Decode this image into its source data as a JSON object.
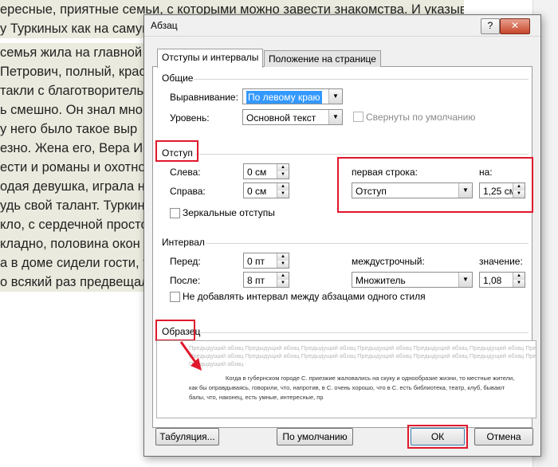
{
  "document": {
    "lines": [
      "ересные, приятные семьи, с которыми можно завести знакомства. И указывали на",
      "у Туркиных как на самую образованную и талантливую.",
      "семья жила на главной ул",
      " Петрович, полный, крас",
      "такли с благотворительн",
      "ь смешно. Он знал много",
      "у него было такое выр",
      "езно. Жена его, Вера Иос",
      "ести и романы и охотно чи",
      "одая девушка, играла на р",
      "удь свой талант. Туркины",
      "кло, с сердечной простот",
      "кладно, половина окон вы",
      "а в доме сидели гости, то",
      "о всякий раз предвещало"
    ]
  },
  "dialog": {
    "title": "Абзац",
    "help": "?",
    "close": "✕",
    "tabs": [
      "Отступы и интервалы",
      "Положение на странице"
    ],
    "general": {
      "header": "Общие",
      "alignment_label": "Выравнивание:",
      "alignment_value": "По левому краю",
      "level_label": "Уровень:",
      "level_value": "Основной текст",
      "collapsed_label": "Свернуты по умолчанию"
    },
    "indent": {
      "header": "Отступ",
      "left_label": "Слева:",
      "left_value": "0 см",
      "right_label": "Справа:",
      "right_value": "0 см",
      "mirror_label": "Зеркальные отступы",
      "first_line_label": "первая строка:",
      "first_line_value": "Отступ",
      "by_label": "на:",
      "by_value": "1,25 см"
    },
    "spacing": {
      "header": "Интервал",
      "before_label": "Перед:",
      "before_value": "0 пт",
      "after_label": "После:",
      "after_value": "8 пт",
      "line_label": "междустрочный:",
      "line_value": "Множитель",
      "at_label": "значение:",
      "at_value": "1,08",
      "no_space_label": "Не добавлять интервал между абзацами одного стиля"
    },
    "preview": {
      "header": "Образец",
      "prev_line1": "Предыдущий абзац Предыдущий абзац Предыдущий абзац Предыдущий абзац Предыдущий абзац Предыдущий абзац Предыдущий абзац",
      "prev_line2": "Предыдущий абзац Предыдущий абзац Предыдущий абзац Предыдущий абзац Предыдущий абзац Предыдущий абзац Предыдущий абзац",
      "prev_line3": "Предыдущий абзац",
      "sample_line1": "Когда в губернском городе С. приезжие жаловались на скуку и однообразие жизни, то местные жители,",
      "sample_line2": "как бы оправдываясь, говорили, что, напротив, в С. очень хорошо, что в С. есть библиотека, театр, клуб, бывают",
      "sample_line3": "балы, что, наконец, есть умные, интересные, пр"
    },
    "buttons": {
      "tabs": "Табуляция...",
      "default": "По умолчанию",
      "ok": "ОК",
      "cancel": "Отмена"
    }
  }
}
